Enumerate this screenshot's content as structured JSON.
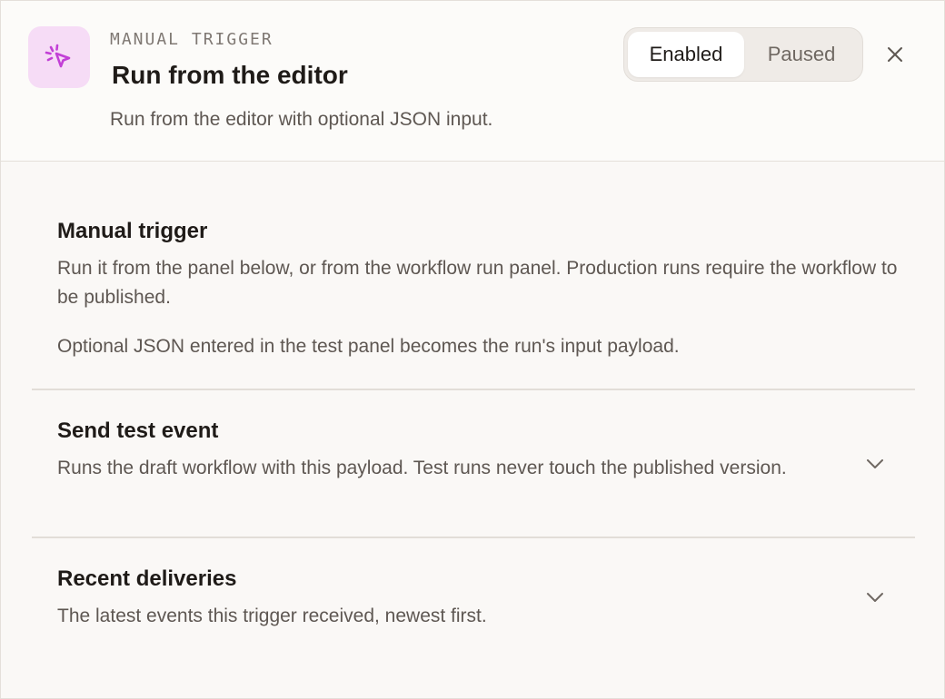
{
  "header": {
    "icon": "cursor-click-icon",
    "eyebrow": "MANUAL TRIGGER",
    "title": "Run from the editor",
    "subtitle": "Run from the editor with optional JSON input.",
    "status_toggle": {
      "options": [
        "Enabled",
        "Paused"
      ],
      "selected": "Enabled"
    },
    "close_icon": "close-icon"
  },
  "sections": [
    {
      "title": "Manual trigger",
      "text_1": "Run it from the panel below, or from the workflow run panel. Production runs require the workflow to be published.",
      "text_2": "Optional JSON entered in the test panel becomes the run's input payload."
    },
    {
      "title": "Send test event",
      "text": "Runs the draft workflow with this payload. Test runs never touch the published version.",
      "expanded": false
    },
    {
      "title": "Recent deliveries",
      "text": "The latest events this trigger received, newest first.",
      "expanded": false
    }
  ],
  "colors": {
    "accent_icon": "#c23fd6",
    "accent_icon_bg": "#f6dcf6"
  }
}
